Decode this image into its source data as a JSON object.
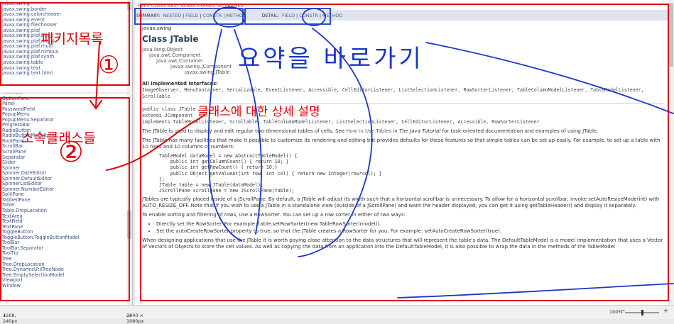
{
  "package_frame": {
    "items": [
      "javax.swing",
      "javax.swing.border",
      "javax.swing.colorchooser",
      "javax.swing.event",
      "javax.swing.filechooser",
      "javax.swing.plaf",
      "javax.swing.plaf.basic",
      "javax.swing.plaf.metal",
      "javax.swing.plaf.multi",
      "javax.swing.plaf.nimbus",
      "javax.swing.plaf.synth",
      "javax.swing.table",
      "javax.swing.text",
      "javax.swing.text.html"
    ]
  },
  "class_frame": {
    "items": [
      "MenuBar",
      "OptionPane",
      "Panel",
      "PasswordField",
      "PopupMenu",
      "PopupMenu.Separator",
      "ProgressBar",
      "RadioButton",
      "RadioButtonMenuItem",
      "RootPane",
      "ScrollBar",
      "ScrollPane",
      "Separator",
      "Slider",
      "Spinner",
      "Spinner.DateEditor",
      "Spinner.DefaultEditor",
      "SpinnerListEditor",
      "Spinner.NumberEditor",
      "SplitPane",
      "TabbedPane",
      "Table",
      "Table.DropLocation",
      "TextArea",
      "TextField",
      "TextPane",
      "ToggleButton",
      "ToggleButton.ToggleButtonModel",
      "ToolBar",
      "ToolBar.Separator",
      "ToolTip",
      "Tree",
      "Tree.DropLocation",
      "Tree.DynamicUtilTreeNode",
      "Tree.EmptySelectionModel",
      "Viewport",
      "Window"
    ]
  },
  "nav": {
    "row1": "PREV CLASS   NEXT CLASS        FRAMES   NO FRAMES",
    "summary_label": "SUMMARY:",
    "summary_nested": "NESTED",
    "summary_field": "FIELD",
    "summary_constr": "CONSTR",
    "summary_method": "METHOD",
    "detail_label": "DETAIL:",
    "detail_field": "FIELD",
    "detail_constr": "CONSTR",
    "detail_method": "METHOD"
  },
  "doc": {
    "package": "javax.swing",
    "class_title": "Class JTable",
    "hierarchy": [
      "java.lang.Object",
      "java.awt.Component",
      "java.awt.Container",
      "javax.swing.JComponent",
      "javax.swing.JTable"
    ],
    "all_interfaces_label": "All Implemented Interfaces:",
    "interfaces": "ImageObserver, MenuContainer, Serializable, EventListener, Accessible, CellEditorListener, ListSelectionListener, RowSorterListener, TableColumnModelListener, TableModelListener, Scrollable",
    "decl1": "public class JTable",
    "decl2": "extends JComponent",
    "decl3": "implements TableModelListener, Scrollable, TableColumnModelListener, ListSelectionListener, CellEditorListener, Accessible, RowSorterListener",
    "para1_a": "The JTable is used to display and edit regular two-dimensional tables of cells. See ",
    "para1_link": "How to Use Tables",
    "para1_b": " in ",
    "para1_ital": "The Java Tutorial",
    "para1_c": " for task-oriented documentation and examples of using JTable.",
    "para2": "The JTable has many facilities that make it possible to customize its rendering and editing but provides defaults for these features so that simple tables can be set up easily. For example, to set up a table with 10 rows and 10 columns of numbers:",
    "code": "TableModel dataModel = new AbstractTableModel() {\n    public int getColumnCount() { return 10; }\n    public int getRowCount() { return 10;}\n    public Object getValueAt(int row, int col) { return new Integer(row*col); }\n};\nJTable table = new JTable(dataModel);\nJScrollPane scrollpane = new JScrollPane(table);",
    "para3": "JTables are typically placed inside of a JScrollPane. By default, a JTable will adjust its width such that a horizontal scrollbar is unnecessary. To allow for a horizontal scrollbar, invoke setAutoResizeMode(int) with AUTO_RESIZE_OFF. Note that if you wish to use a JTable in a standalone view (outside of a JScrollPane) and want the header displayed, you can get it using getTableHeader() and display it separately.",
    "para4": "To enable sorting and filtering of rows, use a RowSorter. You can set up a row sorter in either of two ways:",
    "bullet1": "Directly set the RowSorter. For example: table.setRowSorter(new TableRowSorter(model)).",
    "bullet2": "Set the autoCreateRowSorter property to true, so that the JTable creates a RowSorter for you. For example: setAutoCreateRowSorter(true).",
    "para5": "When designing applications that use the JTable it is worth paying close attention to the data structures that will represent the table's data. The DefaultTableModel is a model implementation that uses a Vector of Vectors of Objects to store the cell values. As well as copying the data from an application into the DefaultTableModel, it is also possible to wrap the data in the methods of the TableModel"
  },
  "status": {
    "cursor": "1268, 240px",
    "size": "3840 × 1080px",
    "zoom": "100%",
    "zoom_level_fraction": 0.5
  },
  "annotations": {
    "package_list": "패키지목록",
    "num1": "①",
    "subclasses": "소속클래스들",
    "num2": "②",
    "class_desc": "클래스에 대한 상세 설명",
    "blue_text": "요약을 바로가기"
  },
  "colors": {
    "annotation_red": "#e0000a",
    "annotation_blue": "#1a37c8"
  }
}
